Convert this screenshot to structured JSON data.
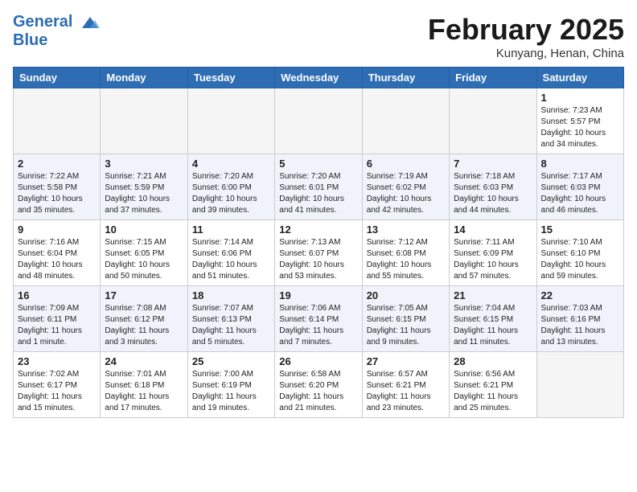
{
  "logo": {
    "line1": "General",
    "line2": "Blue"
  },
  "title": "February 2025",
  "location": "Kunyang, Henan, China",
  "weekdays": [
    "Sunday",
    "Monday",
    "Tuesday",
    "Wednesday",
    "Thursday",
    "Friday",
    "Saturday"
  ],
  "weeks": [
    [
      {
        "day": "",
        "info": ""
      },
      {
        "day": "",
        "info": ""
      },
      {
        "day": "",
        "info": ""
      },
      {
        "day": "",
        "info": ""
      },
      {
        "day": "",
        "info": ""
      },
      {
        "day": "",
        "info": ""
      },
      {
        "day": "1",
        "info": "Sunrise: 7:23 AM\nSunset: 5:57 PM\nDaylight: 10 hours\nand 34 minutes."
      }
    ],
    [
      {
        "day": "2",
        "info": "Sunrise: 7:22 AM\nSunset: 5:58 PM\nDaylight: 10 hours\nand 35 minutes."
      },
      {
        "day": "3",
        "info": "Sunrise: 7:21 AM\nSunset: 5:59 PM\nDaylight: 10 hours\nand 37 minutes."
      },
      {
        "day": "4",
        "info": "Sunrise: 7:20 AM\nSunset: 6:00 PM\nDaylight: 10 hours\nand 39 minutes."
      },
      {
        "day": "5",
        "info": "Sunrise: 7:20 AM\nSunset: 6:01 PM\nDaylight: 10 hours\nand 41 minutes."
      },
      {
        "day": "6",
        "info": "Sunrise: 7:19 AM\nSunset: 6:02 PM\nDaylight: 10 hours\nand 42 minutes."
      },
      {
        "day": "7",
        "info": "Sunrise: 7:18 AM\nSunset: 6:03 PM\nDaylight: 10 hours\nand 44 minutes."
      },
      {
        "day": "8",
        "info": "Sunrise: 7:17 AM\nSunset: 6:03 PM\nDaylight: 10 hours\nand 46 minutes."
      }
    ],
    [
      {
        "day": "9",
        "info": "Sunrise: 7:16 AM\nSunset: 6:04 PM\nDaylight: 10 hours\nand 48 minutes."
      },
      {
        "day": "10",
        "info": "Sunrise: 7:15 AM\nSunset: 6:05 PM\nDaylight: 10 hours\nand 50 minutes."
      },
      {
        "day": "11",
        "info": "Sunrise: 7:14 AM\nSunset: 6:06 PM\nDaylight: 10 hours\nand 51 minutes."
      },
      {
        "day": "12",
        "info": "Sunrise: 7:13 AM\nSunset: 6:07 PM\nDaylight: 10 hours\nand 53 minutes."
      },
      {
        "day": "13",
        "info": "Sunrise: 7:12 AM\nSunset: 6:08 PM\nDaylight: 10 hours\nand 55 minutes."
      },
      {
        "day": "14",
        "info": "Sunrise: 7:11 AM\nSunset: 6:09 PM\nDaylight: 10 hours\nand 57 minutes."
      },
      {
        "day": "15",
        "info": "Sunrise: 7:10 AM\nSunset: 6:10 PM\nDaylight: 10 hours\nand 59 minutes."
      }
    ],
    [
      {
        "day": "16",
        "info": "Sunrise: 7:09 AM\nSunset: 6:11 PM\nDaylight: 11 hours\nand 1 minute."
      },
      {
        "day": "17",
        "info": "Sunrise: 7:08 AM\nSunset: 6:12 PM\nDaylight: 11 hours\nand 3 minutes."
      },
      {
        "day": "18",
        "info": "Sunrise: 7:07 AM\nSunset: 6:13 PM\nDaylight: 11 hours\nand 5 minutes."
      },
      {
        "day": "19",
        "info": "Sunrise: 7:06 AM\nSunset: 6:14 PM\nDaylight: 11 hours\nand 7 minutes."
      },
      {
        "day": "20",
        "info": "Sunrise: 7:05 AM\nSunset: 6:15 PM\nDaylight: 11 hours\nand 9 minutes."
      },
      {
        "day": "21",
        "info": "Sunrise: 7:04 AM\nSunset: 6:15 PM\nDaylight: 11 hours\nand 11 minutes."
      },
      {
        "day": "22",
        "info": "Sunrise: 7:03 AM\nSunset: 6:16 PM\nDaylight: 11 hours\nand 13 minutes."
      }
    ],
    [
      {
        "day": "23",
        "info": "Sunrise: 7:02 AM\nSunset: 6:17 PM\nDaylight: 11 hours\nand 15 minutes."
      },
      {
        "day": "24",
        "info": "Sunrise: 7:01 AM\nSunset: 6:18 PM\nDaylight: 11 hours\nand 17 minutes."
      },
      {
        "day": "25",
        "info": "Sunrise: 7:00 AM\nSunset: 6:19 PM\nDaylight: 11 hours\nand 19 minutes."
      },
      {
        "day": "26",
        "info": "Sunrise: 6:58 AM\nSunset: 6:20 PM\nDaylight: 11 hours\nand 21 minutes."
      },
      {
        "day": "27",
        "info": "Sunrise: 6:57 AM\nSunset: 6:21 PM\nDaylight: 11 hours\nand 23 minutes."
      },
      {
        "day": "28",
        "info": "Sunrise: 6:56 AM\nSunset: 6:21 PM\nDaylight: 11 hours\nand 25 minutes."
      },
      {
        "day": "",
        "info": ""
      }
    ]
  ]
}
